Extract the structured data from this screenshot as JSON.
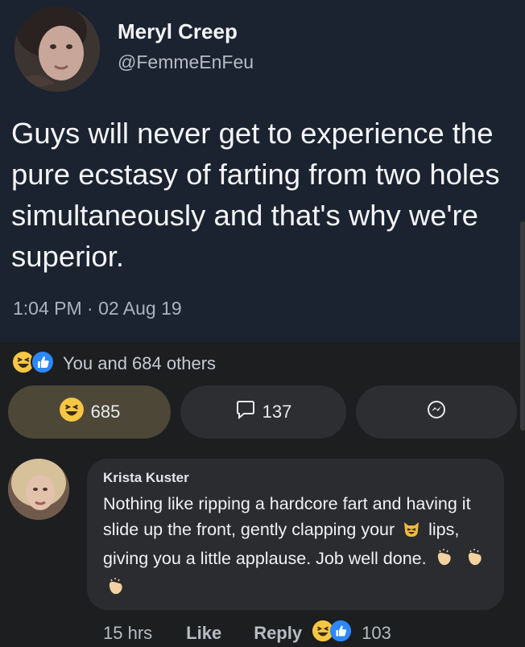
{
  "tweet": {
    "author_name": "Meryl Creep",
    "author_handle": "@FemmeEnFeu",
    "text": "Guys will never get to experience the pure ecstasy of farting from two holes simultaneously and that's why we're superior.",
    "time": "1:04 PM · 02 Aug 19"
  },
  "post": {
    "reaction_summary": "You and 684 others",
    "react_count": "685",
    "comment_count": "137",
    "icons": [
      "haha-emoji-icon",
      "like-emoji-icon",
      "comment-bubble-icon",
      "messenger-icon"
    ]
  },
  "comment": {
    "author": "Krista Kuster",
    "text_before": "Nothing like ripping a hardcore fart and having it slide up the front, gently clapping your",
    "text_after": "lips, giving you a little applause. Job well done.",
    "time": "15 hrs",
    "like_label": "Like",
    "reply_label": "Reply",
    "reaction_count": "103",
    "icons": [
      "cat-emoji-icon",
      "clap-emoji-icon"
    ]
  },
  "colors": {
    "tweet_bg": "#1b2330",
    "page_bg": "#1c1e20",
    "react_pill_bg": "#4d4738",
    "haha_yellow": "#f7c744",
    "like_blue": "#2d88ff"
  }
}
